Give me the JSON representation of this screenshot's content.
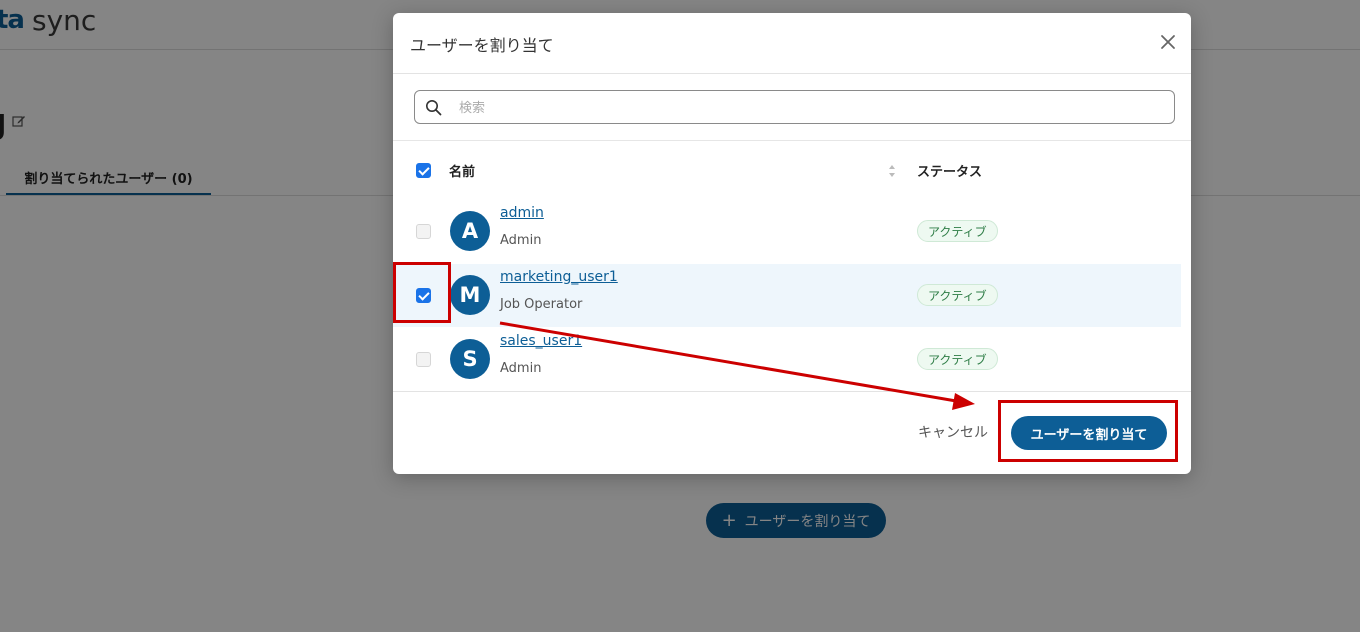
{
  "app": {
    "brand_mark": "ta",
    "brand_text": "sync",
    "title_fragment": "J"
  },
  "background": {
    "tab_assigned_label": "割り当てられたユーザー (0)",
    "assign_button_plus": "+",
    "assign_button_label": "ユーザーを割り当て"
  },
  "modal": {
    "title": "ユーザーを割り当て",
    "search": {
      "placeholder": "検索",
      "value": ""
    },
    "columns": {
      "name": "名前",
      "status": "ステータス"
    },
    "select_all_checked": true,
    "users": [
      {
        "initial": "A",
        "name": "admin",
        "role": "Admin",
        "status": "アクティブ",
        "checked": false
      },
      {
        "initial": "M",
        "name": "marketing_user1",
        "role": "Job Operator",
        "status": "アクティブ",
        "checked": true
      },
      {
        "initial": "S",
        "name": "sales_user1",
        "role": "Admin",
        "status": "アクティブ",
        "checked": false
      }
    ],
    "cancel_label": "キャンセル",
    "assign_label": "ユーザーを割り当て"
  },
  "colors": {
    "primary": "#0d5e96",
    "checkbox": "#1a73e8",
    "active_badge_text": "#2e7d46",
    "annotation": "#cc0000"
  }
}
